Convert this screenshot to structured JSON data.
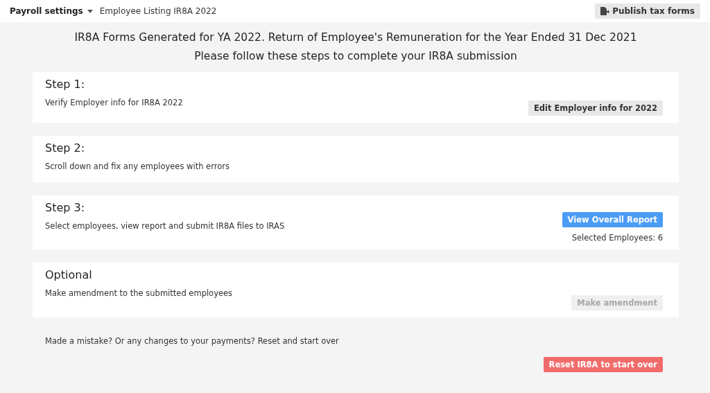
{
  "topbar": {
    "menu": "Payroll settings",
    "breadcrumb": "Employee Listing IR8A 2022",
    "action": "Publish tax forms"
  },
  "heading": "IR8A Forms Generated for YA 2022. Return of Employee's Remuneration for the Year Ended 31 Dec 2021",
  "subheading": "Please follow these steps to complete your IR8A submission",
  "steps": [
    {
      "title": "Step 1:",
      "description": "Verify Employer info for IR8A 2022",
      "button": {
        "label": "Edit Employer info for 2022",
        "kind": "default",
        "disabled": false
      }
    },
    {
      "title": "Step 2:",
      "description": "Scroll down and fix any employees with errors"
    },
    {
      "title": "Step 3:",
      "description": "Select employees, view report and submit IR8A files to IRAS",
      "button": {
        "label": "View Overall Report",
        "kind": "primary",
        "disabled": false
      },
      "note": "Selected Employees: 6"
    },
    {
      "title": "Optional",
      "description": "Make amendment to the submitted employees",
      "button": {
        "label": "Make amendment",
        "kind": "default",
        "disabled": true
      }
    }
  ],
  "reset": {
    "text": "Made a mistake? Or any changes to your payments? Reset and start over",
    "button": {
      "label": "Reset IR8A to start over",
      "kind": "danger",
      "disabled": false
    }
  }
}
